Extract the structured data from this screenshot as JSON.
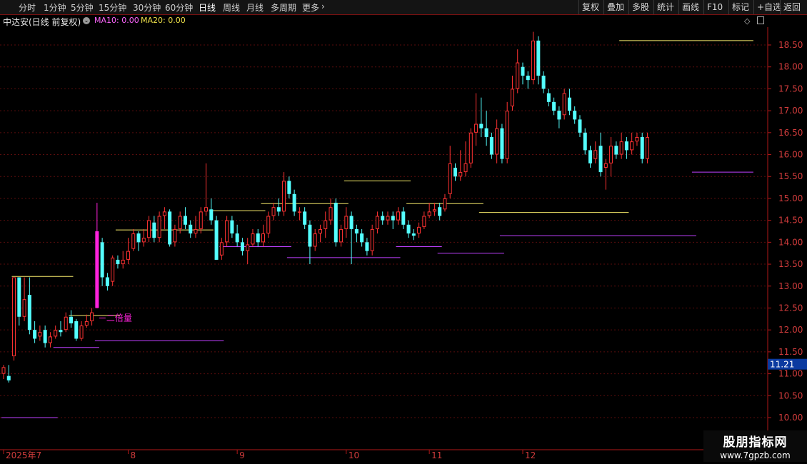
{
  "toolbar": {
    "periods": [
      "分时",
      "1分钟",
      "5分钟",
      "15分钟",
      "30分钟",
      "60分钟",
      "日线",
      "周线",
      "月线",
      "多周期"
    ],
    "active": "日线",
    "more": "更多",
    "right_buttons": [
      "复权",
      "叠加",
      "多股",
      "统计",
      "画线",
      "F10",
      "标记",
      "+自选",
      "返回"
    ]
  },
  "info": {
    "stock_name": "中达安(日线 前复权)",
    "ma10": "MA10: 0.00",
    "ma20": "MA20: 0.00"
  },
  "icons": {
    "info_toggle": "chevron-down-circle-icon",
    "diamond": "diamond-icon",
    "panel": "panel-toggle-icon"
  },
  "colors": {
    "background": "#000000",
    "up": "#ff3232",
    "down": "#54ffff",
    "resistance": "#f5e96a",
    "support": "#c040ff",
    "highlight": "#ff22dd",
    "axis": "#b01818",
    "price_tag_bg": "#0b3aa0"
  },
  "chart_data": {
    "type": "candlestick",
    "title": "中达安(日线 前复权)",
    "ylim": [
      10.0,
      18.8
    ],
    "y_ticks": [
      "18.50",
      "18.00",
      "17.50",
      "17.00",
      "16.50",
      "16.00",
      "15.50",
      "15.00",
      "14.50",
      "14.00",
      "13.50",
      "13.00",
      "12.50",
      "12.00",
      "11.50",
      "11.00",
      "10.50",
      "10.00"
    ],
    "x_ticks": [
      {
        "label": "2025年7",
        "index": 0
      },
      {
        "label": "8",
        "index": 24
      },
      {
        "label": "9",
        "index": 45
      },
      {
        "label": "10",
        "index": 66
      },
      {
        "label": "11",
        "index": 82
      },
      {
        "label": "12",
        "index": 100
      }
    ],
    "current_price": "11.21",
    "annotation": {
      "text": "二倍量",
      "index": 18
    },
    "candles": [
      [
        11.0,
        11.15,
        11.2,
        10.88
      ],
      [
        10.95,
        10.85,
        11.2,
        10.8
      ],
      [
        11.4,
        13.2,
        13.2,
        11.3
      ],
      [
        13.2,
        12.3,
        13.2,
        12.1
      ],
      [
        12.3,
        12.7,
        13.2,
        12.2
      ],
      [
        12.8,
        12.0,
        13.2,
        11.9
      ],
      [
        12.0,
        11.8,
        12.2,
        11.7
      ],
      [
        11.85,
        11.95,
        12.1,
        11.75
      ],
      [
        12.0,
        11.7,
        12.1,
        11.6
      ],
      [
        11.7,
        11.85,
        11.95,
        11.6
      ],
      [
        11.85,
        12.0,
        12.1,
        11.8
      ],
      [
        12.0,
        11.95,
        12.2,
        11.85
      ],
      [
        12.0,
        12.3,
        12.4,
        11.95
      ],
      [
        12.3,
        12.15,
        12.45,
        12.05
      ],
      [
        12.2,
        11.8,
        12.25,
        11.75
      ],
      [
        11.8,
        12.1,
        12.2,
        11.75
      ],
      [
        12.1,
        12.2,
        12.35,
        12.05
      ],
      [
        12.2,
        12.4,
        12.5,
        12.1
      ],
      [
        12.5,
        14.25,
        14.9,
        12.5
      ],
      [
        14.0,
        13.2,
        14.1,
        13.0
      ],
      [
        13.2,
        13.0,
        13.3,
        12.9
      ],
      [
        13.1,
        13.65,
        13.7,
        13.0
      ],
      [
        13.6,
        13.5,
        13.7,
        13.4
      ],
      [
        13.5,
        13.6,
        13.8,
        13.4
      ],
      [
        13.6,
        13.8,
        14.1,
        13.5
      ],
      [
        13.85,
        14.2,
        14.3,
        13.8
      ],
      [
        14.2,
        14.0,
        14.25,
        13.8
      ],
      [
        14.0,
        14.1,
        14.3,
        13.9
      ],
      [
        14.1,
        14.5,
        14.6,
        14.0
      ],
      [
        14.45,
        14.1,
        14.6,
        14.0
      ],
      [
        14.1,
        14.6,
        14.7,
        14.0
      ],
      [
        14.6,
        14.7,
        14.8,
        14.3
      ],
      [
        14.7,
        13.95,
        14.75,
        13.9
      ],
      [
        14.0,
        14.3,
        14.4,
        13.9
      ],
      [
        14.3,
        14.6,
        14.7,
        14.2
      ],
      [
        14.6,
        14.4,
        14.8,
        14.3
      ],
      [
        14.4,
        14.2,
        14.5,
        14.1
      ],
      [
        14.2,
        14.3,
        14.6,
        14.1
      ],
      [
        14.3,
        14.7,
        14.8,
        14.2
      ],
      [
        14.7,
        14.8,
        15.8,
        14.6
      ],
      [
        14.75,
        14.5,
        15.0,
        14.4
      ],
      [
        14.5,
        13.6,
        14.6,
        13.6
      ],
      [
        13.7,
        14.0,
        14.1,
        13.6
      ],
      [
        14.0,
        14.5,
        14.6,
        13.9
      ],
      [
        14.5,
        14.2,
        14.6,
        14.1
      ],
      [
        14.2,
        14.0,
        14.4,
        13.9
      ],
      [
        14.0,
        13.8,
        14.1,
        13.7
      ],
      [
        13.8,
        13.95,
        14.1,
        13.5
      ],
      [
        13.95,
        14.2,
        14.3,
        13.9
      ],
      [
        14.2,
        14.0,
        14.3,
        13.9
      ],
      [
        14.0,
        14.2,
        14.4,
        13.9
      ],
      [
        14.2,
        14.6,
        14.7,
        14.1
      ],
      [
        14.6,
        14.8,
        14.9,
        14.5
      ],
      [
        14.8,
        14.7,
        15.0,
        14.6
      ],
      [
        14.7,
        15.4,
        15.6,
        14.6
      ],
      [
        15.4,
        15.1,
        15.5,
        15.0
      ],
      [
        15.1,
        14.7,
        15.2,
        14.6
      ],
      [
        14.7,
        14.7,
        14.8,
        14.5
      ],
      [
        14.7,
        14.4,
        14.8,
        14.3
      ],
      [
        14.4,
        13.9,
        14.5,
        13.5
      ],
      [
        13.9,
        14.2,
        14.3,
        13.8
      ],
      [
        14.2,
        14.3,
        14.4,
        14.0
      ],
      [
        14.3,
        14.5,
        14.7,
        14.1
      ],
      [
        14.5,
        14.8,
        15.0,
        14.4
      ],
      [
        14.9,
        14.0,
        15.0,
        13.9
      ],
      [
        14.0,
        14.3,
        14.4,
        13.9
      ],
      [
        14.3,
        14.6,
        14.8,
        14.1
      ],
      [
        14.6,
        14.3,
        14.7,
        13.5
      ],
      [
        14.3,
        14.2,
        14.4,
        14.0
      ],
      [
        14.2,
        14.0,
        14.3,
        13.9
      ],
      [
        14.0,
        13.8,
        14.1,
        13.7
      ],
      [
        13.8,
        14.3,
        14.4,
        13.7
      ],
      [
        14.3,
        14.6,
        14.7,
        14.2
      ],
      [
        14.6,
        14.5,
        14.7,
        14.4
      ],
      [
        14.5,
        14.6,
        14.7,
        14.4
      ],
      [
        14.6,
        14.5,
        14.7,
        14.3
      ],
      [
        14.5,
        14.7,
        14.8,
        14.4
      ],
      [
        14.7,
        14.4,
        14.8,
        14.3
      ],
      [
        14.4,
        14.2,
        14.5,
        14.1
      ],
      [
        14.2,
        14.15,
        14.3,
        14.05
      ],
      [
        14.2,
        14.35,
        14.45,
        14.1
      ],
      [
        14.35,
        14.6,
        14.7,
        14.3
      ],
      [
        14.6,
        14.7,
        14.9,
        14.55
      ],
      [
        14.7,
        14.75,
        14.9,
        14.6
      ],
      [
        14.8,
        14.6,
        14.9,
        14.5
      ],
      [
        14.75,
        15.0,
        15.1,
        14.7
      ],
      [
        15.1,
        15.8,
        16.2,
        15.0
      ],
      [
        15.7,
        15.5,
        15.8,
        15.4
      ],
      [
        15.5,
        15.6,
        16.1,
        15.4
      ],
      [
        15.6,
        15.8,
        16.3,
        15.5
      ],
      [
        15.8,
        16.5,
        16.6,
        15.7
      ],
      [
        16.5,
        16.7,
        17.4,
        16.2
      ],
      [
        16.7,
        16.6,
        17.3,
        16.4
      ],
      [
        16.6,
        16.4,
        17.0,
        16.2
      ],
      [
        16.4,
        16.0,
        16.5,
        15.9
      ],
      [
        16.0,
        16.6,
        16.8,
        15.8
      ],
      [
        16.6,
        15.9,
        16.7,
        15.8
      ],
      [
        15.9,
        17.0,
        17.2,
        15.8
      ],
      [
        17.1,
        17.5,
        17.8,
        17.0
      ],
      [
        17.5,
        18.1,
        18.4,
        17.4
      ],
      [
        18.0,
        17.8,
        18.1,
        17.6
      ],
      [
        17.8,
        17.7,
        17.9,
        17.5
      ],
      [
        17.7,
        18.6,
        18.8,
        17.6
      ],
      [
        18.6,
        17.8,
        18.7,
        17.6
      ],
      [
        17.8,
        17.5,
        17.9,
        17.4
      ],
      [
        17.4,
        17.2,
        17.5,
        17.1
      ],
      [
        17.2,
        17.0,
        17.3,
        16.9
      ],
      [
        17.0,
        16.8,
        17.1,
        16.6
      ],
      [
        16.9,
        17.4,
        17.5,
        16.8
      ],
      [
        17.3,
        17.0,
        17.5,
        16.9
      ],
      [
        17.0,
        16.8,
        17.1,
        16.7
      ],
      [
        16.8,
        16.5,
        16.9,
        16.4
      ],
      [
        16.5,
        16.1,
        16.6,
        16.0
      ],
      [
        16.1,
        15.8,
        16.2,
        15.7
      ],
      [
        15.9,
        16.1,
        16.3,
        15.8
      ],
      [
        16.2,
        15.6,
        16.5,
        15.5
      ],
      [
        15.7,
        15.8,
        15.9,
        15.2
      ],
      [
        15.8,
        16.2,
        16.4,
        15.5
      ],
      [
        16.2,
        16.0,
        16.3,
        15.9
      ],
      [
        16.0,
        16.3,
        16.5,
        15.9
      ],
      [
        16.3,
        16.1,
        16.4,
        15.9
      ],
      [
        16.1,
        16.3,
        16.5,
        16.0
      ],
      [
        16.3,
        16.4,
        16.5,
        16.2
      ],
      [
        16.4,
        15.9,
        16.5,
        15.8
      ],
      [
        15.9,
        16.4,
        16.5,
        15.8
      ]
    ],
    "resistance_lines": [
      {
        "price": 13.22,
        "from": 2,
        "to": 13
      },
      {
        "price": 12.33,
        "from": 13,
        "to": 22
      },
      {
        "price": 14.28,
        "from": 22,
        "to": 40
      },
      {
        "price": 14.72,
        "from": 40,
        "to": 50
      },
      {
        "price": 14.88,
        "from": 50,
        "to": 66
      },
      {
        "price": 15.4,
        "from": 66,
        "to": 78
      },
      {
        "price": 14.88,
        "from": 78,
        "to": 92
      },
      {
        "price": 14.68,
        "from": 92,
        "to": 120
      },
      {
        "price": 18.6,
        "from": 119,
        "to": 144
      }
    ],
    "support_lines": [
      {
        "price": 10.0,
        "from": 0,
        "to": 10
      },
      {
        "price": 11.6,
        "from": 10,
        "to": 18
      },
      {
        "price": 11.75,
        "from": 18,
        "to": 42
      },
      {
        "price": 13.9,
        "from": 42,
        "to": 55
      },
      {
        "price": 13.65,
        "from": 55,
        "to": 76
      },
      {
        "price": 13.9,
        "from": 76,
        "to": 84
      },
      {
        "price": 13.75,
        "from": 84,
        "to": 96
      },
      {
        "price": 14.15,
        "from": 96,
        "to": 133
      },
      {
        "price": 15.6,
        "from": 133,
        "to": 144
      }
    ]
  },
  "watermark": {
    "title": "股朋指标网",
    "url": "www.7gpzb.com"
  }
}
